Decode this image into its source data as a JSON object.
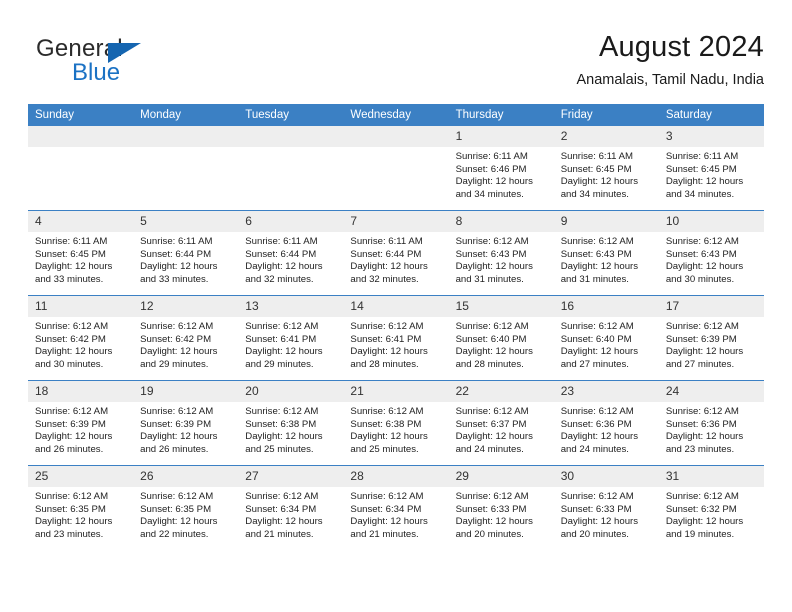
{
  "brand": {
    "name_top": "General",
    "name_bottom": "Blue",
    "triangle_color": "#1565b0",
    "accent_color": "#1b72c4"
  },
  "header": {
    "month_title": "August 2024",
    "location": "Anamalais, Tamil Nadu, India"
  },
  "theme": {
    "header_bg": "#3b80c4",
    "header_text": "#ffffff",
    "daynum_bg": "#eeeeee",
    "row_divider": "#3b80c4"
  },
  "weekday_headers": [
    "Sunday",
    "Monday",
    "Tuesday",
    "Wednesday",
    "Thursday",
    "Friday",
    "Saturday"
  ],
  "labels": {
    "sunrise_prefix": "Sunrise:",
    "sunset_prefix": "Sunset:",
    "daylight_prefix": "Daylight:"
  },
  "weeks": [
    [
      {
        "day": "",
        "sunrise": "",
        "sunset": "",
        "daylight": "",
        "empty": true
      },
      {
        "day": "",
        "sunrise": "",
        "sunset": "",
        "daylight": "",
        "empty": true
      },
      {
        "day": "",
        "sunrise": "",
        "sunset": "",
        "daylight": "",
        "empty": true
      },
      {
        "day": "",
        "sunrise": "",
        "sunset": "",
        "daylight": "",
        "empty": true
      },
      {
        "day": "1",
        "sunrise": "Sunrise: 6:11 AM",
        "sunset": "Sunset: 6:46 PM",
        "daylight": "Daylight: 12 hours and 34 minutes.",
        "empty": false
      },
      {
        "day": "2",
        "sunrise": "Sunrise: 6:11 AM",
        "sunset": "Sunset: 6:45 PM",
        "daylight": "Daylight: 12 hours and 34 minutes.",
        "empty": false
      },
      {
        "day": "3",
        "sunrise": "Sunrise: 6:11 AM",
        "sunset": "Sunset: 6:45 PM",
        "daylight": "Daylight: 12 hours and 34 minutes.",
        "empty": false
      }
    ],
    [
      {
        "day": "4",
        "sunrise": "Sunrise: 6:11 AM",
        "sunset": "Sunset: 6:45 PM",
        "daylight": "Daylight: 12 hours and 33 minutes.",
        "empty": false
      },
      {
        "day": "5",
        "sunrise": "Sunrise: 6:11 AM",
        "sunset": "Sunset: 6:44 PM",
        "daylight": "Daylight: 12 hours and 33 minutes.",
        "empty": false
      },
      {
        "day": "6",
        "sunrise": "Sunrise: 6:11 AM",
        "sunset": "Sunset: 6:44 PM",
        "daylight": "Daylight: 12 hours and 32 minutes.",
        "empty": false
      },
      {
        "day": "7",
        "sunrise": "Sunrise: 6:11 AM",
        "sunset": "Sunset: 6:44 PM",
        "daylight": "Daylight: 12 hours and 32 minutes.",
        "empty": false
      },
      {
        "day": "8",
        "sunrise": "Sunrise: 6:12 AM",
        "sunset": "Sunset: 6:43 PM",
        "daylight": "Daylight: 12 hours and 31 minutes.",
        "empty": false
      },
      {
        "day": "9",
        "sunrise": "Sunrise: 6:12 AM",
        "sunset": "Sunset: 6:43 PM",
        "daylight": "Daylight: 12 hours and 31 minutes.",
        "empty": false
      },
      {
        "day": "10",
        "sunrise": "Sunrise: 6:12 AM",
        "sunset": "Sunset: 6:43 PM",
        "daylight": "Daylight: 12 hours and 30 minutes.",
        "empty": false
      }
    ],
    [
      {
        "day": "11",
        "sunrise": "Sunrise: 6:12 AM",
        "sunset": "Sunset: 6:42 PM",
        "daylight": "Daylight: 12 hours and 30 minutes.",
        "empty": false
      },
      {
        "day": "12",
        "sunrise": "Sunrise: 6:12 AM",
        "sunset": "Sunset: 6:42 PM",
        "daylight": "Daylight: 12 hours and 29 minutes.",
        "empty": false
      },
      {
        "day": "13",
        "sunrise": "Sunrise: 6:12 AM",
        "sunset": "Sunset: 6:41 PM",
        "daylight": "Daylight: 12 hours and 29 minutes.",
        "empty": false
      },
      {
        "day": "14",
        "sunrise": "Sunrise: 6:12 AM",
        "sunset": "Sunset: 6:41 PM",
        "daylight": "Daylight: 12 hours and 28 minutes.",
        "empty": false
      },
      {
        "day": "15",
        "sunrise": "Sunrise: 6:12 AM",
        "sunset": "Sunset: 6:40 PM",
        "daylight": "Daylight: 12 hours and 28 minutes.",
        "empty": false
      },
      {
        "day": "16",
        "sunrise": "Sunrise: 6:12 AM",
        "sunset": "Sunset: 6:40 PM",
        "daylight": "Daylight: 12 hours and 27 minutes.",
        "empty": false
      },
      {
        "day": "17",
        "sunrise": "Sunrise: 6:12 AM",
        "sunset": "Sunset: 6:39 PM",
        "daylight": "Daylight: 12 hours and 27 minutes.",
        "empty": false
      }
    ],
    [
      {
        "day": "18",
        "sunrise": "Sunrise: 6:12 AM",
        "sunset": "Sunset: 6:39 PM",
        "daylight": "Daylight: 12 hours and 26 minutes.",
        "empty": false
      },
      {
        "day": "19",
        "sunrise": "Sunrise: 6:12 AM",
        "sunset": "Sunset: 6:39 PM",
        "daylight": "Daylight: 12 hours and 26 minutes.",
        "empty": false
      },
      {
        "day": "20",
        "sunrise": "Sunrise: 6:12 AM",
        "sunset": "Sunset: 6:38 PM",
        "daylight": "Daylight: 12 hours and 25 minutes.",
        "empty": false
      },
      {
        "day": "21",
        "sunrise": "Sunrise: 6:12 AM",
        "sunset": "Sunset: 6:38 PM",
        "daylight": "Daylight: 12 hours and 25 minutes.",
        "empty": false
      },
      {
        "day": "22",
        "sunrise": "Sunrise: 6:12 AM",
        "sunset": "Sunset: 6:37 PM",
        "daylight": "Daylight: 12 hours and 24 minutes.",
        "empty": false
      },
      {
        "day": "23",
        "sunrise": "Sunrise: 6:12 AM",
        "sunset": "Sunset: 6:36 PM",
        "daylight": "Daylight: 12 hours and 24 minutes.",
        "empty": false
      },
      {
        "day": "24",
        "sunrise": "Sunrise: 6:12 AM",
        "sunset": "Sunset: 6:36 PM",
        "daylight": "Daylight: 12 hours and 23 minutes.",
        "empty": false
      }
    ],
    [
      {
        "day": "25",
        "sunrise": "Sunrise: 6:12 AM",
        "sunset": "Sunset: 6:35 PM",
        "daylight": "Daylight: 12 hours and 23 minutes.",
        "empty": false
      },
      {
        "day": "26",
        "sunrise": "Sunrise: 6:12 AM",
        "sunset": "Sunset: 6:35 PM",
        "daylight": "Daylight: 12 hours and 22 minutes.",
        "empty": false
      },
      {
        "day": "27",
        "sunrise": "Sunrise: 6:12 AM",
        "sunset": "Sunset: 6:34 PM",
        "daylight": "Daylight: 12 hours and 21 minutes.",
        "empty": false
      },
      {
        "day": "28",
        "sunrise": "Sunrise: 6:12 AM",
        "sunset": "Sunset: 6:34 PM",
        "daylight": "Daylight: 12 hours and 21 minutes.",
        "empty": false
      },
      {
        "day": "29",
        "sunrise": "Sunrise: 6:12 AM",
        "sunset": "Sunset: 6:33 PM",
        "daylight": "Daylight: 12 hours and 20 minutes.",
        "empty": false
      },
      {
        "day": "30",
        "sunrise": "Sunrise: 6:12 AM",
        "sunset": "Sunset: 6:33 PM",
        "daylight": "Daylight: 12 hours and 20 minutes.",
        "empty": false
      },
      {
        "day": "31",
        "sunrise": "Sunrise: 6:12 AM",
        "sunset": "Sunset: 6:32 PM",
        "daylight": "Daylight: 12 hours and 19 minutes.",
        "empty": false
      }
    ]
  ]
}
